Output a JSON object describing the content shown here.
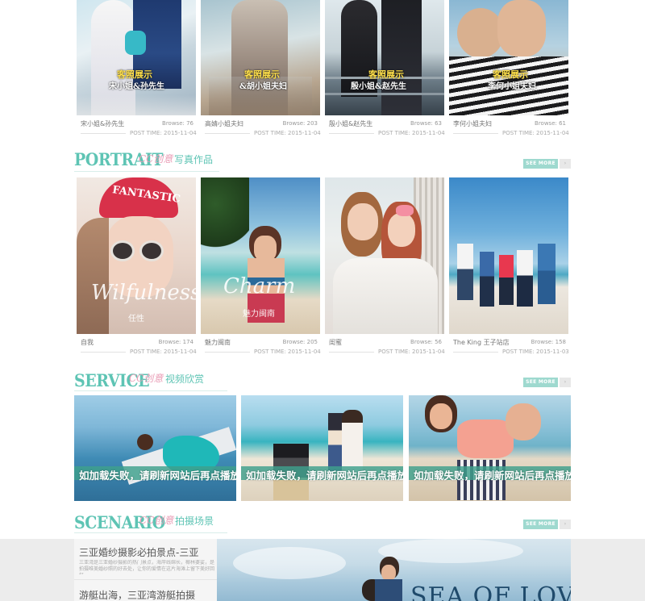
{
  "top_gallery": {
    "items": [
      {
        "name": "宋小姐&孙先生",
        "browse": "Browse: 76",
        "time": "POST TIME: 2015-11-04",
        "stamp1": "客照展示",
        "stamp2": "宋小姐&孙先生"
      },
      {
        "name": "高婧小姐夫妇",
        "browse": "Browse: 203",
        "time": "POST TIME: 2015-11-04",
        "stamp1": "客照展示",
        "stamp2": "&胡小姐夫妇"
      },
      {
        "name": "殷小姐&赵先生",
        "browse": "Browse: 63",
        "time": "POST TIME: 2015-11-04",
        "stamp1": "客照展示",
        "stamp2": "殷小姐&赵先生"
      },
      {
        "name": "李何小姐夫妇",
        "browse": "Browse: 61",
        "time": "POST TIME: 2015-11-04",
        "stamp1": "客照展示",
        "stamp2": "李何小姐夫妇"
      }
    ]
  },
  "portrait": {
    "title_en": "PORTRAIT",
    "title_cc": "CC创意",
    "title_cn": "写真作品",
    "see_more": "SEE MORE",
    "arrow": "›",
    "items": [
      {
        "name": "自我",
        "browse": "Browse: 174",
        "time": "POST TIME: 2015-11-04",
        "script": "Wilfulness",
        "sub": "任性",
        "hat": "FANTASTIC"
      },
      {
        "name": "魅力闽南",
        "browse": "Browse: 205",
        "time": "POST TIME: 2015-11-04",
        "script": "Charm",
        "sub": "魅力闽南"
      },
      {
        "name": "闺蜜",
        "browse": "Browse: 56",
        "time": "POST TIME: 2015-11-04",
        "script": "",
        "sub": ""
      },
      {
        "name": "The King 王子站店",
        "browse": "Browse: 158",
        "time": "POST TIME: 2015-11-03",
        "script": "",
        "sub": ""
      }
    ]
  },
  "service": {
    "title_en": "SERVICE",
    "title_cc": "CC创意",
    "title_cn": "视频欣赏",
    "see_more": "SEE MORE",
    "arrow": "›",
    "items": [
      {
        "overlay": "如加载失败，请刷新网站后再点播放"
      },
      {
        "overlay": "如加载失败，请刷新网站后再点播放"
      },
      {
        "overlay": "如加载失败，请刷新网站后再点播放"
      }
    ]
  },
  "scenario": {
    "title_en": "SCENARIO",
    "title_cc": "CC创意",
    "title_cn": "拍摄场景",
    "see_more": "SEE MORE",
    "arrow": "›",
    "list": [
      {
        "title": "三亚婚纱摄影必拍景点-三亚",
        "desc": "三亚湾是三亚婚纱摄影的热门景点，海岸线绵长，椰林婆娑，是拍摄唯美婚纱照的好去处，让你的爱情在这片海滩上留下美好回忆。"
      },
      {
        "title": "游艇出海，三亚湾游艇拍摄",
        "desc": ""
      }
    ],
    "banner_text": "SEA OF LOVE"
  },
  "colors": {
    "accent": "#5ec4b4",
    "pink": "#e99db6",
    "overlay": "#3ea08c"
  }
}
